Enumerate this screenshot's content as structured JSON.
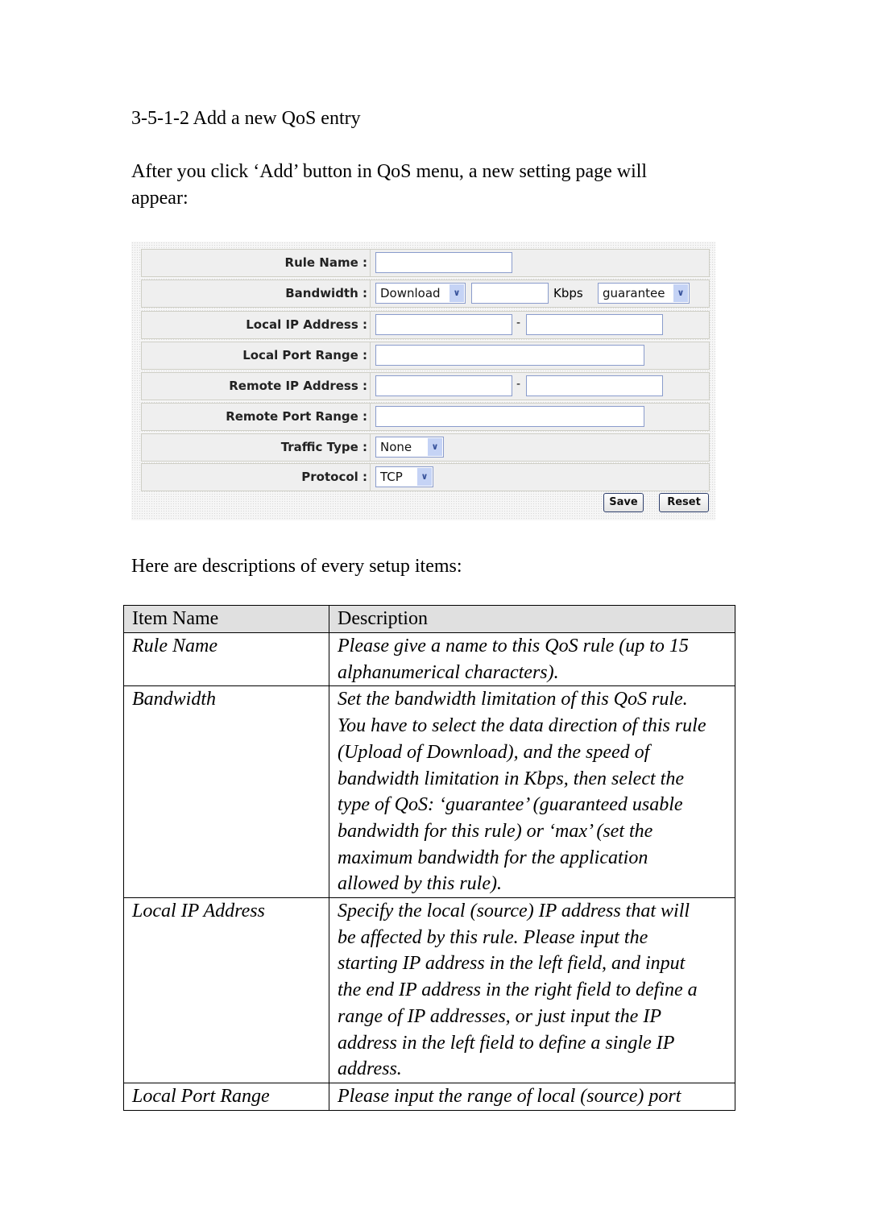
{
  "heading": "3-5-1-2 Add a new QoS entry",
  "intro_lines": [
    "After you click ‘Add’ button in QoS menu, a new setting page will",
    "appear:"
  ],
  "form": {
    "rule_name_label": "Rule Name :",
    "bandwidth_label": "Bandwidth :",
    "bandwidth_direction": "Download",
    "bandwidth_unit": "Kbps",
    "bandwidth_type": "guarantee",
    "local_ip_label": "Local IP Address :",
    "local_port_label": "Local Port Range :",
    "remote_ip_label": "Remote IP Address :",
    "remote_port_label": "Remote Port Range :",
    "traffic_type_label": "Traffic Type :",
    "traffic_type_value": "None",
    "protocol_label": "Protocol :",
    "protocol_value": "TCP",
    "range_separator": "-",
    "save_label": "Save",
    "reset_label": "Reset"
  },
  "desc_intro": "Here are descriptions of every setup items:",
  "table": {
    "headers": [
      "Item Name",
      "Description"
    ],
    "rows": [
      {
        "name": "Rule Name",
        "lines": [
          "Please give a name to this QoS rule (up to 15",
          "alphanumerical characters)."
        ]
      },
      {
        "name": "Bandwidth",
        "lines": [
          "Set the bandwidth limitation of this QoS rule.",
          "You have to select the data direction of this rule",
          "(Upload of Download), and the speed of",
          "bandwidth limitation in Kbps, then select the",
          "type of QoS: ‘guarantee’ (guaranteed usable",
          "bandwidth for this rule) or ‘max’ (set the",
          "maximum bandwidth for the application",
          "allowed by this rule)."
        ]
      },
      {
        "name": "Local IP Address",
        "lines": [
          "Specify the local (source) IP address that will",
          "be affected by this rule. Please input the",
          "starting IP address in the left field, and input",
          "the end IP address in the right field to define a",
          "range of IP addresses, or just input the IP",
          "address in the left field to define a single IP",
          "address."
        ]
      },
      {
        "name": "Local Port Range",
        "lines": [
          "Please input the range of local (source) port"
        ]
      }
    ]
  }
}
